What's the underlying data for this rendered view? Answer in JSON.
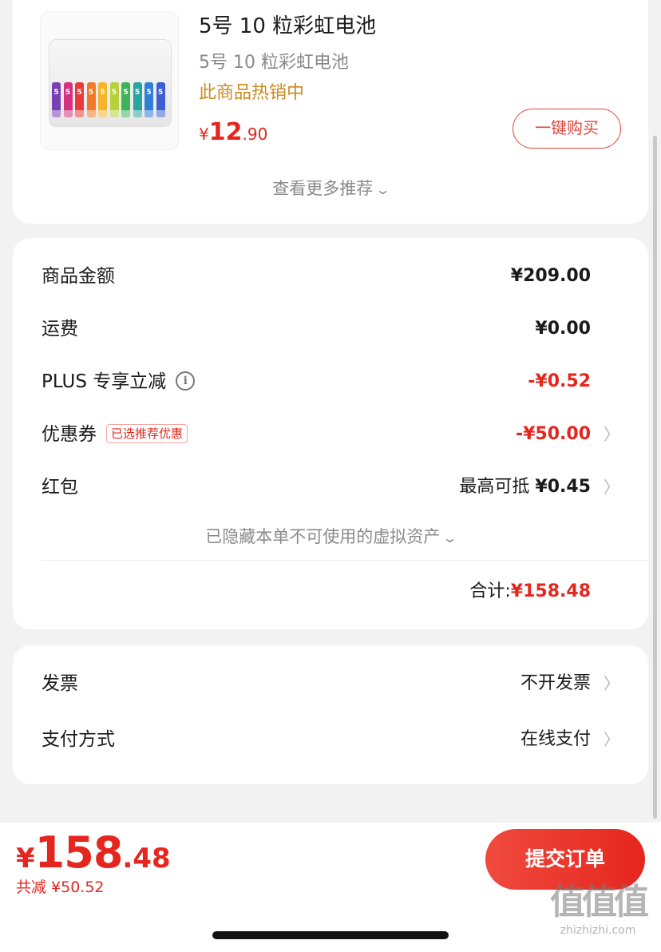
{
  "product": {
    "title": "5号 10 粒彩虹电池",
    "subtitle": "5号 10 粒彩虹电池",
    "hot_label": "此商品热销中",
    "price_currency": "¥",
    "price_int": "12",
    "price_dec": ".90",
    "buy_button": "一键购买",
    "battery_label": "5",
    "battery_colors": [
      "#7b3fb5",
      "#d6327f",
      "#e83c3c",
      "#f07a2a",
      "#f4b52a",
      "#b6d13a",
      "#3cb45a",
      "#2aa6a0",
      "#2f7fd6",
      "#3d5fd1"
    ]
  },
  "more_recommend": "查看更多推荐",
  "amounts": {
    "rows": [
      {
        "label": "商品金额",
        "value": "¥209.00"
      },
      {
        "label": "运费",
        "value": "¥0.00"
      },
      {
        "label": "PLUS 专享立减",
        "value": "-¥0.52"
      },
      {
        "label": "优惠券",
        "tag": "已选推荐优惠",
        "value": "-¥50.00"
      },
      {
        "label": "红包",
        "value_prefix": "最高可抵 ",
        "value": "¥0.45"
      }
    ],
    "hidden_note": "已隐藏本单不可使用的虚拟资产",
    "total_label": "合计:",
    "total_value": "¥158.48"
  },
  "pay": {
    "rows": [
      {
        "label": "发票",
        "value": "不开发票"
      },
      {
        "label": "支付方式",
        "value": "在线支付"
      }
    ]
  },
  "bottom": {
    "currency": "¥",
    "int": "158",
    "dec": ".48",
    "saved": "共减 ¥50.52",
    "submit": "提交订单"
  },
  "watermark": {
    "big": "值值值",
    "small": "zhizhizhi.com"
  },
  "colors": {
    "accent": "#e5261e",
    "hot": "#c98a1f"
  }
}
